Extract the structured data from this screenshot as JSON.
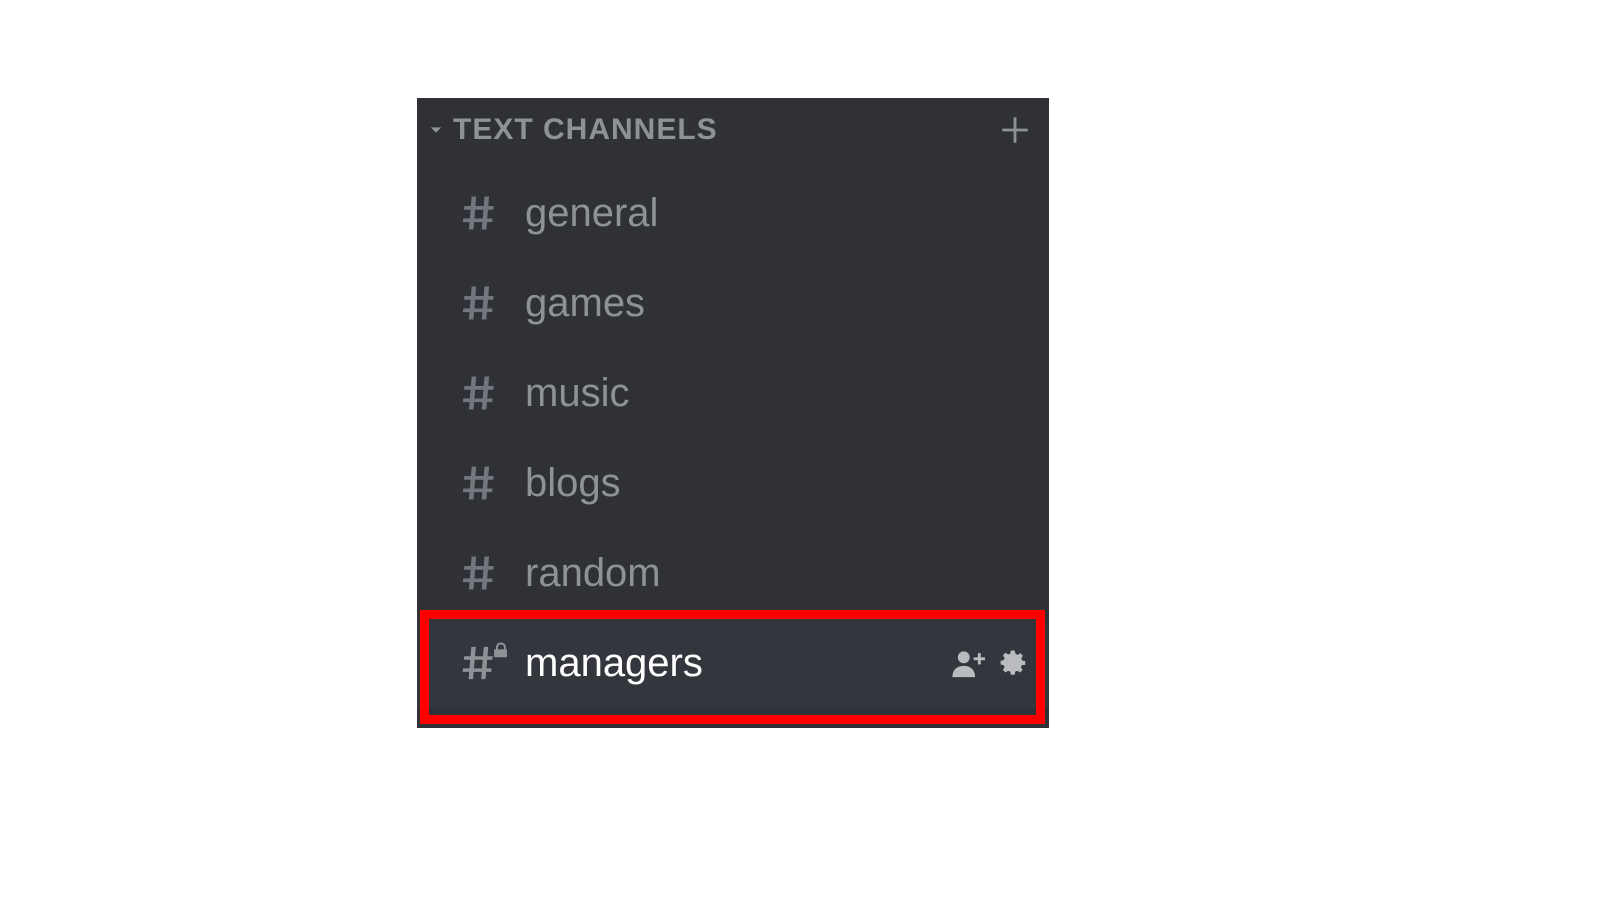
{
  "category": {
    "label": "TEXT CHANNELS"
  },
  "channels": [
    {
      "name": "general",
      "locked": false,
      "hovered": false
    },
    {
      "name": "games",
      "locked": false,
      "hovered": false
    },
    {
      "name": "music",
      "locked": false,
      "hovered": false
    },
    {
      "name": "blogs",
      "locked": false,
      "hovered": false
    },
    {
      "name": "random",
      "locked": false,
      "hovered": false
    },
    {
      "name": "managers",
      "locked": true,
      "hovered": true
    }
  ]
}
